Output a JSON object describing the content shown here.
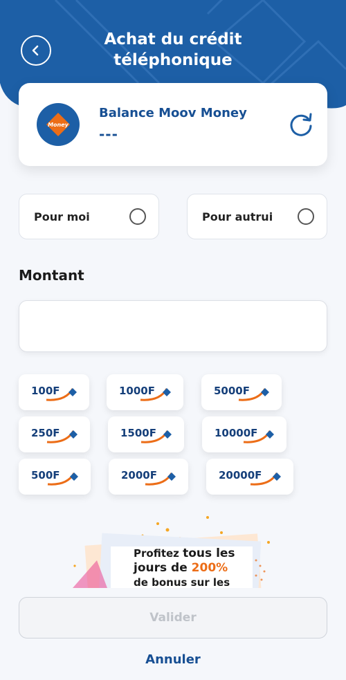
{
  "header": {
    "title_line1": "Achat du crédit",
    "title_line2": "téléphonique",
    "brand_color": "#1d5fa6"
  },
  "balance": {
    "label": "Balance Moov Money",
    "value": "---",
    "logo_text": "Money"
  },
  "recipient_options": [
    {
      "label": "Pour moi",
      "selected": false
    },
    {
      "label": "Pour autrui",
      "selected": false
    }
  ],
  "amount": {
    "title": "Montant",
    "value": "",
    "placeholder": ""
  },
  "quick_amounts": [
    "100F",
    "1000F",
    "5000F",
    "250F",
    "1500F",
    "10000F",
    "500F",
    "2000F",
    "20000F"
  ],
  "promo": {
    "text_a": "Profitez ",
    "text_b": "tous les",
    "text_c": "jours de ",
    "text_d": "200%",
    "text_e": "de bonus sur les"
  },
  "actions": {
    "validate_label": "Valider",
    "cancel_label": "Annuler"
  },
  "icons": {
    "back": "chevron-left-icon",
    "refresh": "refresh-icon",
    "radio": "radio-unchecked-icon"
  },
  "colors": {
    "primary": "#174f93",
    "accent": "#ec6d17"
  }
}
